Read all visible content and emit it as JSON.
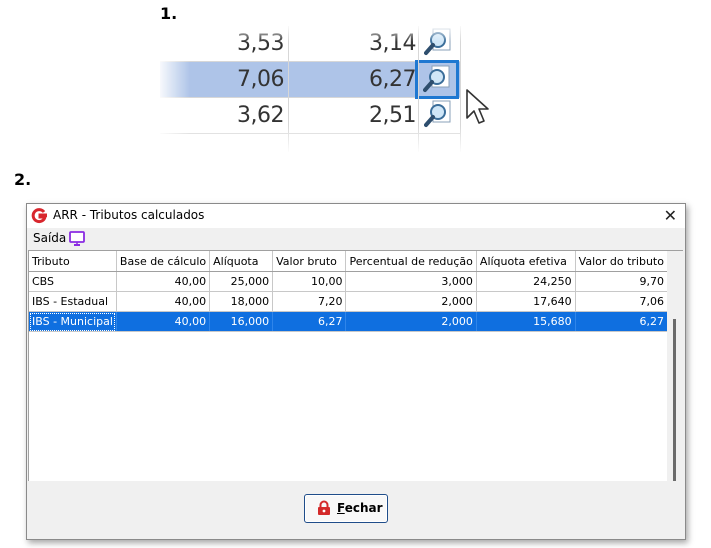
{
  "steps": {
    "step1": "1.",
    "step2": "2."
  },
  "zoom": {
    "rows": [
      {
        "c1": "3,53",
        "c2": "3,14",
        "selected": false
      },
      {
        "c1": "7,06",
        "c2": "6,27",
        "selected": true
      },
      {
        "c1": "3,62",
        "c2": "2,51",
        "selected": false
      }
    ]
  },
  "dialog": {
    "title": "ARR - Tributos calculados",
    "menu": {
      "saida": "Saída"
    },
    "columns": [
      "Tributo",
      "Base de cálculo",
      "Alíquota",
      "Valor bruto",
      "Percentual de redução",
      "Alíquota efetiva",
      "Valor do tributo"
    ],
    "rows": [
      {
        "tributo": "CBS",
        "base": "40,00",
        "aliquota": "25,000",
        "bruto": "10,00",
        "reducao": "3,000",
        "efetiva": "24,250",
        "valor": "9,70",
        "selected": false
      },
      {
        "tributo": "IBS - Estadual",
        "base": "40,00",
        "aliquota": "18,000",
        "bruto": "7,20",
        "reducao": "2,000",
        "efetiva": "17,640",
        "valor": "7,06",
        "selected": false
      },
      {
        "tributo": "IBS - Municipal",
        "base": "40,00",
        "aliquota": "16,000",
        "bruto": "6,27",
        "reducao": "2,000",
        "efetiva": "15,680",
        "valor": "6,27",
        "selected": true
      }
    ],
    "button": {
      "prefix": "F",
      "rest": "echar"
    }
  },
  "colors": {
    "selection": "#0f6fe0",
    "zoom_selection": "#aec4e8",
    "focus_outline": "#1f78d1",
    "monitor_icon": "#8a2be2",
    "lock_icon": "#d42a2a",
    "app_icon": "#d8262d"
  },
  "icons": [
    "magnifier-icon",
    "mouse-cursor-icon",
    "app-logo-icon",
    "monitor-icon",
    "close-icon",
    "lock-icon"
  ]
}
